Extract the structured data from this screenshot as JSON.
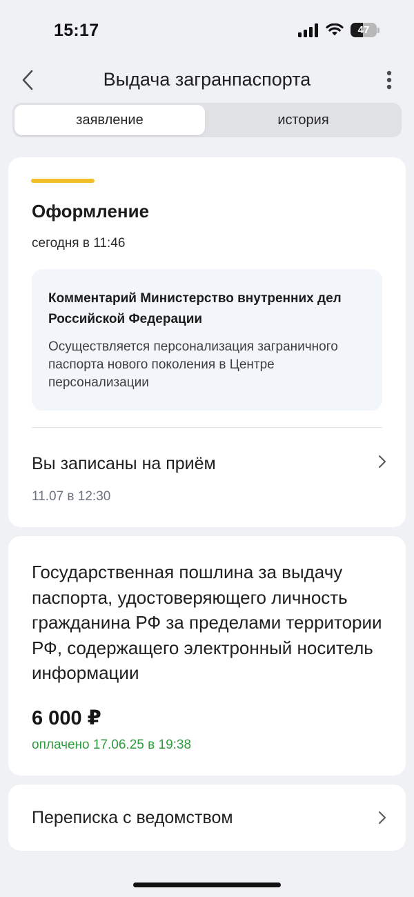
{
  "status_bar": {
    "time": "15:17",
    "battery_level": "47",
    "battery_fraction": 0.47
  },
  "header": {
    "title": "Выдача загранпаспорта"
  },
  "tabs": [
    {
      "label": "заявление",
      "active": true
    },
    {
      "label": "история",
      "active": false
    }
  ],
  "status_card": {
    "stage_title": "Оформление",
    "stage_time": "сегодня в 11:46",
    "accent_color": "#f2be2a",
    "comment_title": "Комментарий Министерство внутренних дел Российской Федерации",
    "comment_text": "Осуществляется персонализация заграничного паспорта нового поколения в Центре персонализации",
    "appointment_title": "Вы записаны на приём",
    "appointment_date": "11.07 в 12:30"
  },
  "fee_card": {
    "title": "Государственная пошлина за выдачу паспорта, удостоверяющего личность гражданина РФ за пределами территории РФ, содержащего электронный носитель информации",
    "amount": "6 000 ₽",
    "paid_status": "оплачено 17.06.25 в 19:38",
    "paid_color": "#2e9b3e"
  },
  "correspondence": {
    "label": "Переписка с ведомством"
  },
  "icons": {
    "back": "chevron-left-icon",
    "more": "more-vertical-icon",
    "chevron": "chevron-right-icon",
    "signal": "signal-icon",
    "wifi": "wifi-icon",
    "battery": "battery-icon"
  }
}
